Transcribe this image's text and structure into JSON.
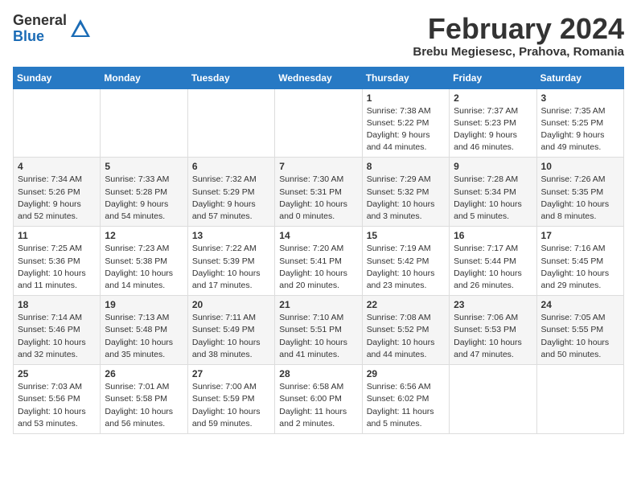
{
  "logo": {
    "general": "General",
    "blue": "Blue"
  },
  "title": {
    "month_year": "February 2024",
    "location": "Brebu Megiesesc, Prahova, Romania"
  },
  "weekdays": [
    "Sunday",
    "Monday",
    "Tuesday",
    "Wednesday",
    "Thursday",
    "Friday",
    "Saturday"
  ],
  "weeks": [
    [
      {
        "day": "",
        "info": ""
      },
      {
        "day": "",
        "info": ""
      },
      {
        "day": "",
        "info": ""
      },
      {
        "day": "",
        "info": ""
      },
      {
        "day": "1",
        "info": "Sunrise: 7:38 AM\nSunset: 5:22 PM\nDaylight: 9 hours and 44 minutes."
      },
      {
        "day": "2",
        "info": "Sunrise: 7:37 AM\nSunset: 5:23 PM\nDaylight: 9 hours and 46 minutes."
      },
      {
        "day": "3",
        "info": "Sunrise: 7:35 AM\nSunset: 5:25 PM\nDaylight: 9 hours and 49 minutes."
      }
    ],
    [
      {
        "day": "4",
        "info": "Sunrise: 7:34 AM\nSunset: 5:26 PM\nDaylight: 9 hours and 52 minutes."
      },
      {
        "day": "5",
        "info": "Sunrise: 7:33 AM\nSunset: 5:28 PM\nDaylight: 9 hours and 54 minutes."
      },
      {
        "day": "6",
        "info": "Sunrise: 7:32 AM\nSunset: 5:29 PM\nDaylight: 9 hours and 57 minutes."
      },
      {
        "day": "7",
        "info": "Sunrise: 7:30 AM\nSunset: 5:31 PM\nDaylight: 10 hours and 0 minutes."
      },
      {
        "day": "8",
        "info": "Sunrise: 7:29 AM\nSunset: 5:32 PM\nDaylight: 10 hours and 3 minutes."
      },
      {
        "day": "9",
        "info": "Sunrise: 7:28 AM\nSunset: 5:34 PM\nDaylight: 10 hours and 5 minutes."
      },
      {
        "day": "10",
        "info": "Sunrise: 7:26 AM\nSunset: 5:35 PM\nDaylight: 10 hours and 8 minutes."
      }
    ],
    [
      {
        "day": "11",
        "info": "Sunrise: 7:25 AM\nSunset: 5:36 PM\nDaylight: 10 hours and 11 minutes."
      },
      {
        "day": "12",
        "info": "Sunrise: 7:23 AM\nSunset: 5:38 PM\nDaylight: 10 hours and 14 minutes."
      },
      {
        "day": "13",
        "info": "Sunrise: 7:22 AM\nSunset: 5:39 PM\nDaylight: 10 hours and 17 minutes."
      },
      {
        "day": "14",
        "info": "Sunrise: 7:20 AM\nSunset: 5:41 PM\nDaylight: 10 hours and 20 minutes."
      },
      {
        "day": "15",
        "info": "Sunrise: 7:19 AM\nSunset: 5:42 PM\nDaylight: 10 hours and 23 minutes."
      },
      {
        "day": "16",
        "info": "Sunrise: 7:17 AM\nSunset: 5:44 PM\nDaylight: 10 hours and 26 minutes."
      },
      {
        "day": "17",
        "info": "Sunrise: 7:16 AM\nSunset: 5:45 PM\nDaylight: 10 hours and 29 minutes."
      }
    ],
    [
      {
        "day": "18",
        "info": "Sunrise: 7:14 AM\nSunset: 5:46 PM\nDaylight: 10 hours and 32 minutes."
      },
      {
        "day": "19",
        "info": "Sunrise: 7:13 AM\nSunset: 5:48 PM\nDaylight: 10 hours and 35 minutes."
      },
      {
        "day": "20",
        "info": "Sunrise: 7:11 AM\nSunset: 5:49 PM\nDaylight: 10 hours and 38 minutes."
      },
      {
        "day": "21",
        "info": "Sunrise: 7:10 AM\nSunset: 5:51 PM\nDaylight: 10 hours and 41 minutes."
      },
      {
        "day": "22",
        "info": "Sunrise: 7:08 AM\nSunset: 5:52 PM\nDaylight: 10 hours and 44 minutes."
      },
      {
        "day": "23",
        "info": "Sunrise: 7:06 AM\nSunset: 5:53 PM\nDaylight: 10 hours and 47 minutes."
      },
      {
        "day": "24",
        "info": "Sunrise: 7:05 AM\nSunset: 5:55 PM\nDaylight: 10 hours and 50 minutes."
      }
    ],
    [
      {
        "day": "25",
        "info": "Sunrise: 7:03 AM\nSunset: 5:56 PM\nDaylight: 10 hours and 53 minutes."
      },
      {
        "day": "26",
        "info": "Sunrise: 7:01 AM\nSunset: 5:58 PM\nDaylight: 10 hours and 56 minutes."
      },
      {
        "day": "27",
        "info": "Sunrise: 7:00 AM\nSunset: 5:59 PM\nDaylight: 10 hours and 59 minutes."
      },
      {
        "day": "28",
        "info": "Sunrise: 6:58 AM\nSunset: 6:00 PM\nDaylight: 11 hours and 2 minutes."
      },
      {
        "day": "29",
        "info": "Sunrise: 6:56 AM\nSunset: 6:02 PM\nDaylight: 11 hours and 5 minutes."
      },
      {
        "day": "",
        "info": ""
      },
      {
        "day": "",
        "info": ""
      }
    ]
  ]
}
